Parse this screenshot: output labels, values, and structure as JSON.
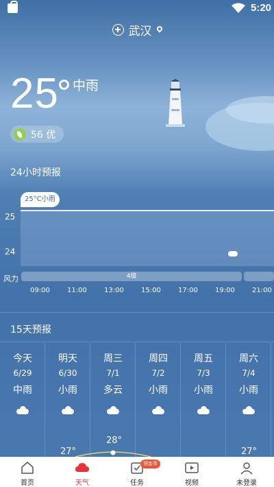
{
  "status_bar": {
    "time": "5:20"
  },
  "header": {
    "city": "武汉"
  },
  "current": {
    "temp": "25",
    "condition": "中雨",
    "aqi": "56 优"
  },
  "hourly": {
    "title": "24小时预报",
    "tooltip": "25°C小雨",
    "y_labels": [
      "25",
      "24"
    ],
    "wind_label": "风力",
    "wind_value": "4级",
    "times": [
      "09:00",
      "11:00",
      "13:00",
      "15:00",
      "17:00",
      "19:00",
      "21:00"
    ]
  },
  "daily": {
    "title": "15天预报",
    "days": [
      {
        "name": "今天",
        "date": "6/29",
        "cond": "中雨"
      },
      {
        "name": "明天",
        "date": "6/30",
        "cond": "小雨"
      },
      {
        "name": "周三",
        "date": "7/1",
        "cond": "多云"
      },
      {
        "name": "周四",
        "date": "7/2",
        "cond": "小雨"
      },
      {
        "name": "周五",
        "date": "7/3",
        "cond": "小雨"
      },
      {
        "name": "周六",
        "date": "7/4",
        "cond": "小雨"
      }
    ],
    "highs": [
      "27°",
      "28°",
      "27°"
    ]
  },
  "nav": {
    "items": [
      "首页",
      "天气",
      "任务",
      "视频",
      "未登录"
    ],
    "badge": "领金币",
    "active_color": "#e8323a"
  }
}
